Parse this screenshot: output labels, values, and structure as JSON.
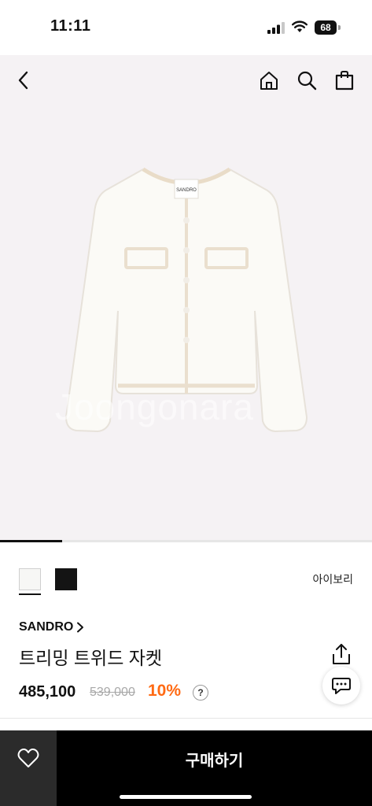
{
  "status": {
    "time": "11:11",
    "battery": "68"
  },
  "nav": {
    "back_icon": "chevron-left-icon",
    "home_icon": "home-icon",
    "search_icon": "search-icon",
    "bag_icon": "shopping-bag-icon"
  },
  "product_image": {
    "jacket_label": "SANDRO",
    "watermark": "Joongonara"
  },
  "gallery": {
    "progress": 0.167
  },
  "options": {
    "swatches": [
      {
        "name": "ivory",
        "color": "#f7f7f5",
        "selected": true
      },
      {
        "name": "black",
        "color": "#141414",
        "selected": false
      }
    ],
    "selected_color_label": "아이보리"
  },
  "product": {
    "brand": "SANDRO",
    "name": "트리밍 트위드 자켓",
    "price": "485,100",
    "original_price": "539,000",
    "discount": "10%",
    "help": "?"
  },
  "actions": {
    "share_icon": "share-icon",
    "chat_icon": "chat-bubble-icon",
    "wishlist_icon": "heart-icon",
    "buy_label": "구매하기"
  },
  "colors": {
    "accent": "#ff6a13",
    "bottom_bar": "#000000",
    "image_bg": "#f5f2f4"
  }
}
